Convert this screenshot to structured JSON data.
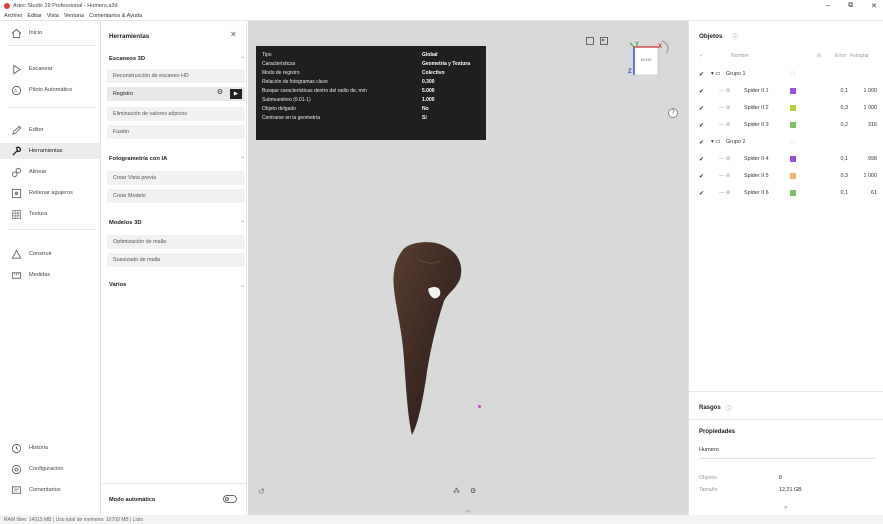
{
  "window": {
    "title": "Artec Studio 19 Professional - Humero.a3d",
    "controls": [
      "–",
      "⧉",
      "✕"
    ]
  },
  "menu": [
    "Archivo",
    "Editar",
    "Vista",
    "Ventana",
    "Comentarios & Ayuda"
  ],
  "nav": {
    "items": [
      {
        "label": "Inicio",
        "icon": "home-icon"
      },
      {
        "label": "Escanear",
        "icon": "scan-icon"
      },
      {
        "label": "Piloto Automático",
        "icon": "autopilot-icon"
      },
      {
        "label": "Editor",
        "icon": "pencil-icon"
      },
      {
        "label": "Herramientas",
        "icon": "tools-icon"
      },
      {
        "label": "Alinear",
        "icon": "align-icon"
      },
      {
        "label": "Rellenar agujeros",
        "icon": "fill-holes-icon"
      },
      {
        "label": "Textura",
        "icon": "texture-icon"
      },
      {
        "label": "Construir",
        "icon": "build-icon"
      },
      {
        "label": "Medidas",
        "icon": "ruler-icon"
      }
    ],
    "bottom": [
      {
        "label": "Historia",
        "icon": "history-icon"
      },
      {
        "label": "Configuración",
        "icon": "settings-icon"
      },
      {
        "label": "Comentarios",
        "icon": "comments-icon"
      }
    ]
  },
  "tools": {
    "title": "Herramientas",
    "close": "✕",
    "sections": [
      {
        "label": "Escaneos 3D",
        "items": [
          "Reconstrucción de escaneo HD",
          "Registro",
          "Eliminación de valores atípicos",
          "Fusión"
        ]
      },
      {
        "label": "Fotogrametría con IA",
        "items": [
          "Crear Vista previa",
          "Crear Modelo"
        ]
      },
      {
        "label": "Modelos 3D",
        "items": [
          "Optimización de malla",
          "Suavizado de malla"
        ]
      },
      {
        "label": "Varios",
        "items": []
      }
    ],
    "auto_mode": "Modo automático"
  },
  "params": [
    {
      "k": "Tipo",
      "v": "Global"
    },
    {
      "k": "Características",
      "v": "Geometría y Textura"
    },
    {
      "k": "Modo de registro",
      "v": "Colectivo"
    },
    {
      "k": "Relación de fotogramas clave",
      "v": "0.300"
    },
    {
      "k": "Busque características dentro del radio de, mm",
      "v": "5.000"
    },
    {
      "k": "Submuestreo (0.01-1)",
      "v": "1.000"
    },
    {
      "k": "Objeto delgado",
      "v": "No"
    },
    {
      "k": "Centrarse en la geometría",
      "v": "Sí"
    }
  ],
  "gizmo": {
    "y": "Y",
    "x": "X",
    "z": "Z",
    "face": "ECHO"
  },
  "objects": {
    "title": "Objetos",
    "headers": {
      "name": "Nombre",
      "error": "Error",
      "frames": "Fotograr"
    },
    "rows": [
      {
        "kind": "group",
        "name": "Grupo 1",
        "error": "",
        "frames": ""
      },
      {
        "kind": "scan",
        "name": "Spider II 1",
        "color": "#9b4fd6",
        "error": "0,1",
        "frames": "1 000"
      },
      {
        "kind": "scan",
        "name": "Spider II 2",
        "color": "#b7cf3a",
        "error": "0,3",
        "frames": "1 000"
      },
      {
        "kind": "scan",
        "name": "Spider II 3",
        "color": "#7cc36a",
        "error": "0,2",
        "frames": "316"
      },
      {
        "kind": "group",
        "name": "Grupo 2",
        "error": "",
        "frames": ""
      },
      {
        "kind": "scan",
        "name": "Spider II 4",
        "color": "#9b4fd6",
        "error": "0,1",
        "frames": "998"
      },
      {
        "kind": "scan",
        "name": "Spider II 5",
        "color": "#f0b36a",
        "error": "0,3",
        "frames": "1 000"
      },
      {
        "kind": "scan",
        "name": "Spider II 6",
        "color": "#7cc36a",
        "error": "0,1",
        "frames": "61"
      }
    ]
  },
  "features": {
    "title": "Rasgos"
  },
  "properties": {
    "title": "Propiedades",
    "name": "Humero",
    "objects_label": "Objetos",
    "objects_value": "8",
    "size_label": "Tamaño",
    "size_value": "12,21 GB"
  },
  "status": "RAM libre: 14915 MB  |  Uso total de memoria: 10709 MB  |  Listo"
}
